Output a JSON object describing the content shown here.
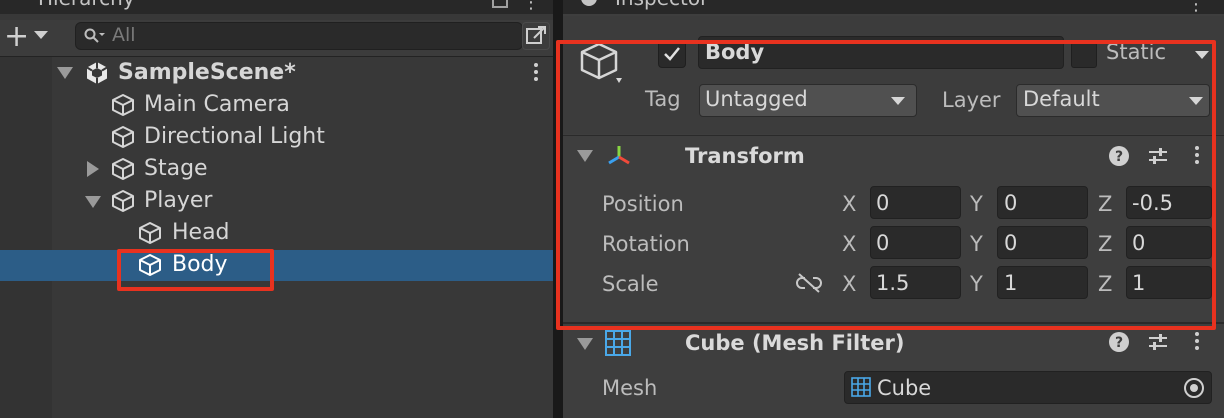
{
  "hierarchy": {
    "tab_title": "Hierarchy",
    "search_placeholder": "All",
    "scene": {
      "name": "SampleScene*"
    },
    "items": [
      {
        "label": "Main Camera"
      },
      {
        "label": "Directional Light"
      },
      {
        "label": "Stage"
      },
      {
        "label": "Player"
      },
      {
        "label": "Head"
      },
      {
        "label": "Body"
      }
    ],
    "selected": "Body"
  },
  "inspector": {
    "tab_title": "Inspector",
    "object": {
      "active": true,
      "name": "Body",
      "static_label": "Static",
      "tag_label": "Tag",
      "tag_value": "Untagged",
      "layer_label": "Layer",
      "layer_value": "Default"
    },
    "transform": {
      "title": "Transform",
      "position": {
        "label": "Position",
        "x": "0",
        "y": "0",
        "z": "-0.5"
      },
      "rotation": {
        "label": "Rotation",
        "x": "0",
        "y": "0",
        "z": "0"
      },
      "scale": {
        "label": "Scale",
        "x": "1.5",
        "y": "1",
        "z": "1"
      },
      "axis_x": "X",
      "axis_y": "Y",
      "axis_z": "Z"
    },
    "mesh_filter": {
      "title": "Cube (Mesh Filter)",
      "mesh_label": "Mesh",
      "mesh_value": "Cube"
    }
  },
  "colors": {
    "selection": "#2c5d87",
    "highlight_box": "#e8321f",
    "panel_bg": "#383838",
    "inspector_bg": "#3e3e3e"
  }
}
